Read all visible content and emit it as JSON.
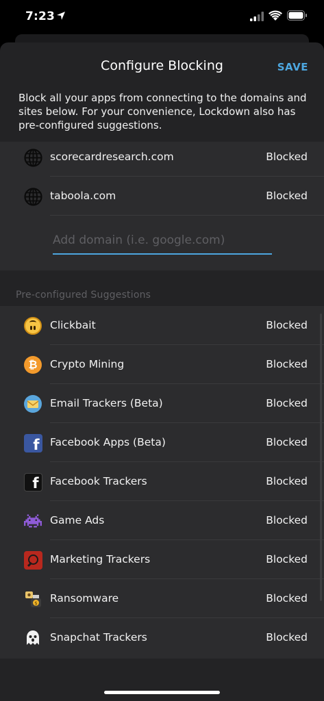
{
  "status_bar": {
    "time": "7:23"
  },
  "header": {
    "title": "Configure Blocking",
    "save_label": "SAVE"
  },
  "intro_text": "Block all your apps from connecting to the domains and sites below. For your convenience, Lockdown also has pre-configured suggestions.",
  "custom_domains": [
    {
      "label": "scorecardresearch.com",
      "status": "Blocked",
      "icon": "globe-icon"
    },
    {
      "label": "taboola.com",
      "status": "Blocked",
      "icon": "globe-icon"
    }
  ],
  "add_domain": {
    "placeholder": "Add domain (i.e. google.com)",
    "value": ""
  },
  "suggestions_header": "Pre-configured Suggestions",
  "suggestions": [
    {
      "label": "Clickbait",
      "status": "Blocked",
      "icon": "upside-down-face-icon"
    },
    {
      "label": "Crypto Mining",
      "status": "Blocked",
      "icon": "bitcoin-icon"
    },
    {
      "label": "Email Trackers (Beta)",
      "status": "Blocked",
      "icon": "email-icon"
    },
    {
      "label": "Facebook Apps (Beta)",
      "status": "Blocked",
      "icon": "facebook-blue-icon"
    },
    {
      "label": "Facebook Trackers",
      "status": "Blocked",
      "icon": "facebook-black-icon"
    },
    {
      "label": "Game Ads",
      "status": "Blocked",
      "icon": "space-invader-icon"
    },
    {
      "label": "Marketing Trackers",
      "status": "Blocked",
      "icon": "magnifier-icon"
    },
    {
      "label": "Ransomware",
      "status": "Blocked",
      "icon": "ransomware-icon"
    },
    {
      "label": "Snapchat Trackers",
      "status": "Blocked",
      "icon": "ghost-icon"
    }
  ],
  "colors": {
    "accent": "#4da7e0",
    "background": "#232325",
    "section": "#2c2c2e"
  }
}
